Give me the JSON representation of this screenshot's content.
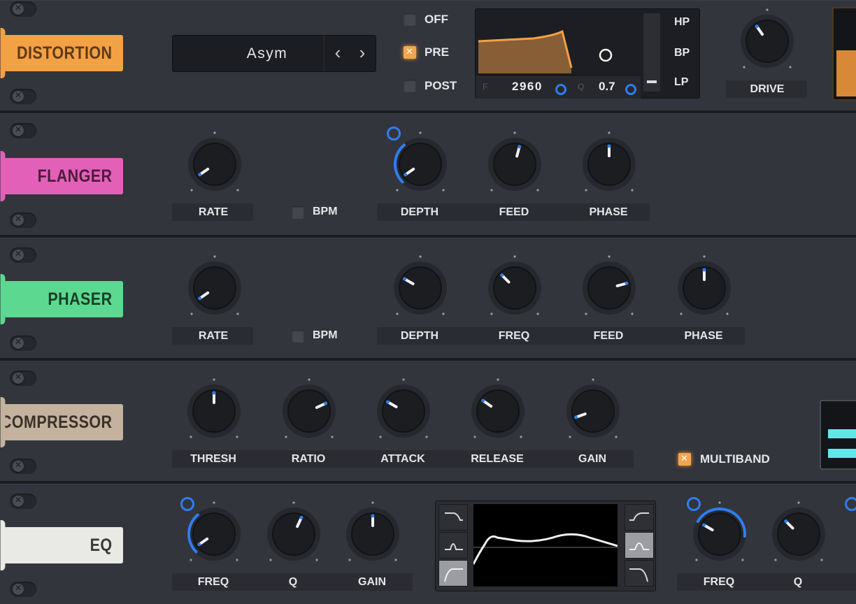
{
  "colors": {
    "distortion": "#f2a145",
    "flanger": "#e260b8",
    "phaser": "#5cd891",
    "compressor": "#c3b29d",
    "eq": "#e9e9e6",
    "accent_blue": "#2f7df0",
    "meter_cyan": "#5fe7ea"
  },
  "distortion": {
    "title": "DISTORTION",
    "preset": {
      "name": "Asym",
      "prev_icon": "‹",
      "next_icon": "›"
    },
    "route": {
      "off": "OFF",
      "pre": "PRE",
      "post": "POST",
      "selected": "PRE"
    },
    "filter": {
      "freq_prefix": "F",
      "freq_value": "2960",
      "q_prefix": "Q",
      "q_value": "0.7",
      "types": [
        "HP",
        "BP",
        "LP"
      ],
      "selected_type": "LP"
    },
    "knob_label": "DRIVE"
  },
  "flanger": {
    "title": "FLANGER",
    "labels": {
      "rate": "RATE",
      "bpm": "BPM",
      "depth": "DEPTH",
      "feed": "FEED",
      "phase": "PHASE"
    }
  },
  "phaser": {
    "title": "PHASER",
    "labels": {
      "rate": "RATE",
      "bpm": "BPM",
      "depth": "DEPTH",
      "freq": "FREQ",
      "feed": "FEED",
      "phase": "PHASE"
    }
  },
  "compressor": {
    "title": "COMPRESSOR",
    "labels": {
      "thresh": "THRESH",
      "ratio": "RATIO",
      "attack": "ATTACK",
      "release": "RELEASE",
      "gain": "GAIN"
    },
    "multiband": "MULTIBAND"
  },
  "eq": {
    "title": "EQ",
    "labels": {
      "freq": "FREQ",
      "q": "Q",
      "gain": "GAIN",
      "freq2": "FREQ",
      "q2": "Q"
    }
  }
}
